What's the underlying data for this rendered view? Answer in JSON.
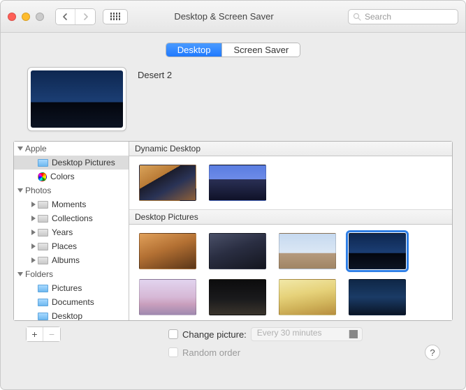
{
  "title": "Desktop & Screen Saver",
  "search_placeholder": "Search",
  "tabs": {
    "desktop": "Desktop",
    "screensaver": "Screen Saver"
  },
  "current_name": "Desert 2",
  "sidebar": {
    "apple": {
      "label": "Apple",
      "desktop_pictures": "Desktop Pictures",
      "colors": "Colors"
    },
    "photos": {
      "label": "Photos",
      "moments": "Moments",
      "collections": "Collections",
      "years": "Years",
      "places": "Places",
      "albums": "Albums"
    },
    "folders": {
      "label": "Folders",
      "pictures": "Pictures",
      "documents": "Documents",
      "desktop": "Desktop"
    }
  },
  "sections": {
    "dynamic": "Dynamic Desktop",
    "desktop_pictures": "Desktop Pictures"
  },
  "footer": {
    "change_picture": "Change picture:",
    "interval": "Every 30 minutes",
    "random": "Random order",
    "help": "?"
  },
  "thumbs": {
    "dynamic": [
      "linear-gradient(150deg,#d9a35a 0%,#b97a35 35%,#1b1c2b 35%,#2a3356 60%,#8f6038 100%)",
      "linear-gradient(180deg,#5a7de0 0%,#6d8be8 40%,#2a2f55 40%,#0f1228 100%)"
    ],
    "pics": [
      "linear-gradient(160deg,#e0a05a 0%,#b37033 45%,#8b5526 70%,#5a3618 100%)",
      "linear-gradient(160deg,#4a5068 0%,#2a2e42 45%,#14161f 100%)",
      "linear-gradient(180deg,#c6d9ef 0%,#dbe7f5 55%,#b59a7e 56%,#a08564 100%)",
      "linear-gradient(180deg,#0e2750 0%,#1b3e74 55%,#03060e 56%,#0c1322 100%)",
      "linear-gradient(180deg,#e2d4ef 0%,#d6b8d6 50%,#c99fbd 70%,#9f89af 100%)",
      "linear-gradient(180deg,#0c0c0d 0%,#1a1a1c 55%,#3a342c 100%)",
      "linear-gradient(170deg,#f1e8a8 0%,#e6d27a 40%,#d0b35a 70%,#b88e3f 100%)",
      "linear-gradient(180deg,#0f2747 0%,#1a3b66 50%,#0a1526 100%)",
      "linear-gradient(180deg,#2b3558 0%,#3c486f 100%)",
      "linear-gradient(180deg,#cd7a5a 0%,#d39070 50%,#a69088 100%)",
      "linear-gradient(180deg,#e09060 0%,#d88858 50%,#b87050 100%)",
      "linear-gradient(180deg,#3a4468 0%,#4c5880 100%)"
    ],
    "selected_index": 3,
    "preview": "linear-gradient(180deg,#0e2750 0%,#1b3e74 55%,#03060e 56%,#0c1322 100%)"
  }
}
